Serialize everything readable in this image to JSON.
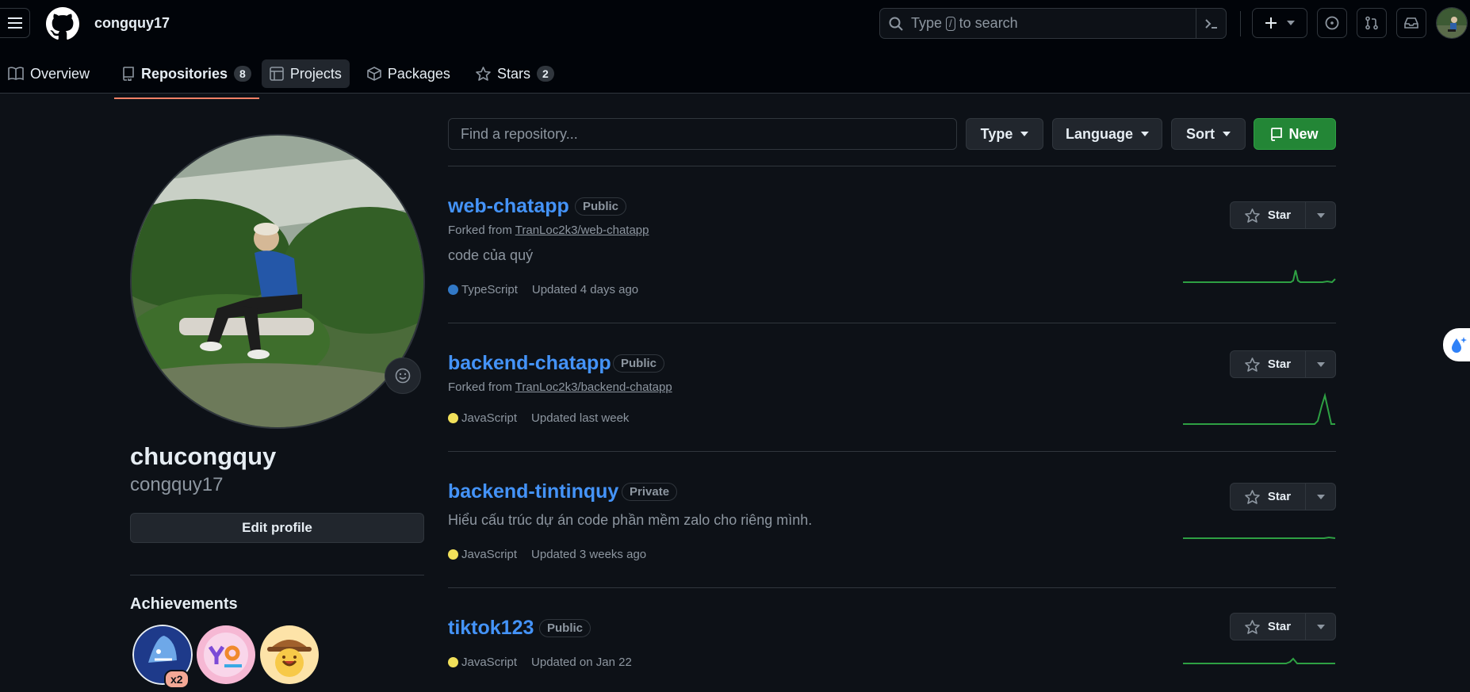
{
  "header": {
    "username": "congquy17",
    "search_placeholder_before": "Type",
    "search_slash": "/",
    "search_placeholder_after": "to search"
  },
  "tabs": [
    {
      "label": "Overview",
      "icon": "book-icon"
    },
    {
      "label": "Repositories",
      "icon": "repo-icon",
      "count": "8"
    },
    {
      "label": "Projects",
      "icon": "table-icon"
    },
    {
      "label": "Packages",
      "icon": "package-icon"
    },
    {
      "label": "Stars",
      "icon": "star-icon",
      "count": "2"
    }
  ],
  "profile": {
    "name": "chucongquy",
    "login": "congquy17",
    "edit_label": "Edit profile",
    "achievements_title": "Achievements",
    "achievement_multiplier": "x2"
  },
  "filters": {
    "find_placeholder": "Find a repository...",
    "type_label": "Type",
    "language_label": "Language",
    "sort_label": "Sort",
    "new_label": "New"
  },
  "repos": [
    {
      "name": "web-chatapp",
      "visibility": "Public",
      "fork_prefix": "Forked from",
      "fork_source": "TranLoc2k3/web-chatapp",
      "description": "code của quý",
      "language": "TypeScript",
      "language_color": "#3178c6",
      "updated": "Updated 4 days ago",
      "star_label": "Star"
    },
    {
      "name": "backend-chatapp",
      "visibility": "Public",
      "fork_prefix": "Forked from",
      "fork_source": "TranLoc2k3/backend-chatapp",
      "description": "",
      "language": "JavaScript",
      "language_color": "#f1e05a",
      "updated": "Updated last week",
      "star_label": "Star"
    },
    {
      "name": "backend-tintinquy",
      "visibility": "Private",
      "fork_prefix": "",
      "fork_source": "",
      "description": "Hiểu cấu trúc dự án code phần mềm zalo cho riêng mình.",
      "language": "JavaScript",
      "language_color": "#f1e05a",
      "updated": "Updated 3 weeks ago",
      "star_label": "Star"
    },
    {
      "name": "tiktok123",
      "visibility": "Public",
      "fork_prefix": "",
      "fork_source": "",
      "description": "",
      "language": "JavaScript",
      "language_color": "#f1e05a",
      "updated": "Updated on Jan 22",
      "star_label": "Star"
    }
  ],
  "colors": {
    "accent": "#4493f8",
    "tab_underline": "#f78166",
    "new_button": "#238636",
    "spark": "#2ea043"
  }
}
